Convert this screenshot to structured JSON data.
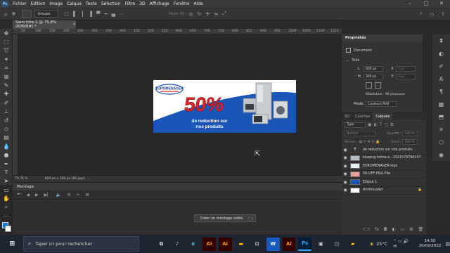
{
  "menubar": {
    "logo": "Ps",
    "items": [
      "Fichier",
      "Edition",
      "Image",
      "Calque",
      "Texte",
      "Sélection",
      "Filtre",
      "3D",
      "Affichage",
      "Fenêtre",
      "Aide"
    ]
  },
  "options": {
    "group_select": "Groupe",
    "mode3d": "Mode 3D :"
  },
  "document": {
    "tab_title": "Sans titre-1 @ 75,8% (RVB/8#) *",
    "ruler_ticks": [
      "50",
      "100",
      "150",
      "200",
      "250",
      "300",
      "350",
      "400",
      "450",
      "500",
      "550",
      "600",
      "650",
      "700",
      "750",
      "800",
      "850",
      "900",
      "950",
      "1000",
      "1050",
      "1100",
      "1150"
    ]
  },
  "banner": {
    "brand": "EUROMENAGER",
    "percent": "50%",
    "line1": "de reduction sur",
    "line2": "nos produits"
  },
  "status": {
    "zoom": "75,76 %",
    "size": "800 px x 300 px (96 ppp)"
  },
  "timeline": {
    "title": "Montage",
    "create_button": "Créer un montage vidéo"
  },
  "properties": {
    "title": "Propriétés",
    "document_label": "Document",
    "canvas_label": "Toile",
    "w_label": "L",
    "w_value": "800 px",
    "x_label": "X",
    "x_value": "0 px",
    "h_label": "H",
    "h_value": "300 px",
    "y_label": "Y",
    "y_value": "0 px",
    "resolution": "Résolution : 96 px/pouce",
    "mode_label": "Mode",
    "mode_value": "Couleurs RVB"
  },
  "layers": {
    "tabs": [
      "3D",
      "Couches",
      "Calques"
    ],
    "active_tab": "Calques",
    "filter": "Type",
    "blend": "Normal",
    "opacity_label": "Opacité :",
    "opacity": "100 %",
    "lock_label": "Verrou :",
    "fill_label": "Fond :",
    "fill": "100 %",
    "items": [
      {
        "name": "de reduction sur  nos produits",
        "type": "text"
      },
      {
        "name": "kisspng-home-a...1521578796247",
        "type": "image"
      },
      {
        "name": "EUROMENAGER-logo",
        "type": "image"
      },
      {
        "name": "50-OFF-PNG-File",
        "type": "image"
      },
      {
        "name": "Ellipse 1",
        "type": "shape"
      },
      {
        "name": "Arrière-plan",
        "type": "background"
      }
    ]
  },
  "taskbar": {
    "search_placeholder": "Taper ici pour rechercher",
    "apps": [
      "Ai",
      "Ai",
      "W",
      "Ai",
      "Ps"
    ],
    "temperature": "25°C",
    "time": "14:50",
    "date": "20/02/2022"
  },
  "colors": {
    "accent_blue": "#1a56b8",
    "banner_red": "#d9262b",
    "photoshop_blue": "#31a8ff"
  }
}
